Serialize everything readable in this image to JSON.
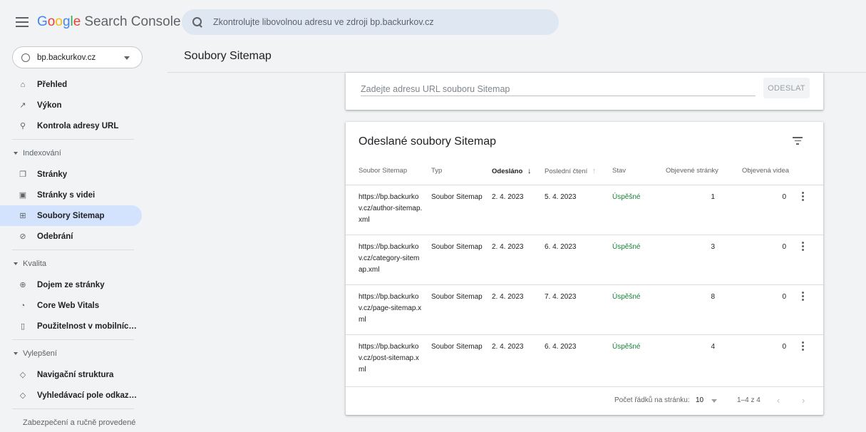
{
  "app": {
    "logo_google": [
      "G",
      "o",
      "o",
      "g",
      "l",
      "e"
    ],
    "logo_rest": "Search Console"
  },
  "search": {
    "placeholder": "Zkontrolujte libovolnou adresu ve zdroji bp.backurkov.cz"
  },
  "property": {
    "name": "bp.backurkov.cz"
  },
  "page_title": "Soubory Sitemap",
  "sidebar": {
    "top_items": [
      {
        "label": "Přehled",
        "icon": "home-icon"
      },
      {
        "label": "Výkon",
        "icon": "trending-icon"
      },
      {
        "label": "Kontrola adresy URL",
        "icon": "search-icon"
      }
    ],
    "indexing": {
      "title": "Indexování",
      "items": [
        {
          "label": "Stránky",
          "icon": "pages-icon"
        },
        {
          "label": "Stránky s videi",
          "icon": "video-pages-icon"
        },
        {
          "label": "Soubory Sitemap",
          "icon": "sitemap-icon",
          "active": true
        },
        {
          "label": "Odebrání",
          "icon": "removal-icon"
        }
      ]
    },
    "quality": {
      "title": "Kvalita",
      "items": [
        {
          "label": "Dojem ze stránky",
          "icon": "plus-circle-icon"
        },
        {
          "label": "Core Web Vitals",
          "icon": "gauge-icon"
        },
        {
          "label": "Použitelnost v mobilníc…",
          "icon": "phone-icon"
        }
      ]
    },
    "enhancements": {
      "title": "Vylepšení",
      "items": [
        {
          "label": "Navigační struktura",
          "icon": "layers-icon"
        },
        {
          "label": "Vyhledávací pole odkaz…",
          "icon": "layers-icon"
        }
      ]
    },
    "security": {
      "title": "Zabezpečení a ručně provedené"
    }
  },
  "submit": {
    "placeholder": "Zadejte adresu URL souboru Sitemap",
    "button": "ODESLAT"
  },
  "table": {
    "title": "Odeslané soubory Sitemap",
    "headers": {
      "file": "Soubor Sitemap",
      "type": "Typ",
      "submitted": "Odesláno",
      "last_read": "Poslední čtení",
      "status": "Stav",
      "pages": "Objevené stránky",
      "videos": "Objevená videa"
    },
    "rows": [
      {
        "file": "https://bp.backurkov.cz/author-sitemap.xml",
        "type": "Soubor Sitemap",
        "submitted": "2. 4. 2023",
        "last_read": "5. 4. 2023",
        "status": "Úspěšné",
        "pages": "1",
        "videos": "0"
      },
      {
        "file": "https://bp.backurkov.cz/category-sitemap.xml",
        "type": "Soubor Sitemap",
        "submitted": "2. 4. 2023",
        "last_read": "6. 4. 2023",
        "status": "Úspěšné",
        "pages": "3",
        "videos": "0"
      },
      {
        "file": "https://bp.backurkov.cz/page-sitemap.xml",
        "type": "Soubor Sitemap",
        "submitted": "2. 4. 2023",
        "last_read": "7. 4. 2023",
        "status": "Úspěšné",
        "pages": "8",
        "videos": "0"
      },
      {
        "file": "https://bp.backurkov.cz/post-sitemap.xml",
        "type": "Soubor Sitemap",
        "submitted": "2. 4. 2023",
        "last_read": "6. 4. 2023",
        "status": "Úspěšné",
        "pages": "4",
        "videos": "0"
      }
    ],
    "footer": {
      "rows_per_page_label": "Počet řádků na stránku:",
      "rows_per_page": "10",
      "range": "1–4 z 4"
    }
  },
  "colors": {
    "accent": "#d3e3fd",
    "success": "#188038",
    "search_bg": "#dfe7f3"
  }
}
